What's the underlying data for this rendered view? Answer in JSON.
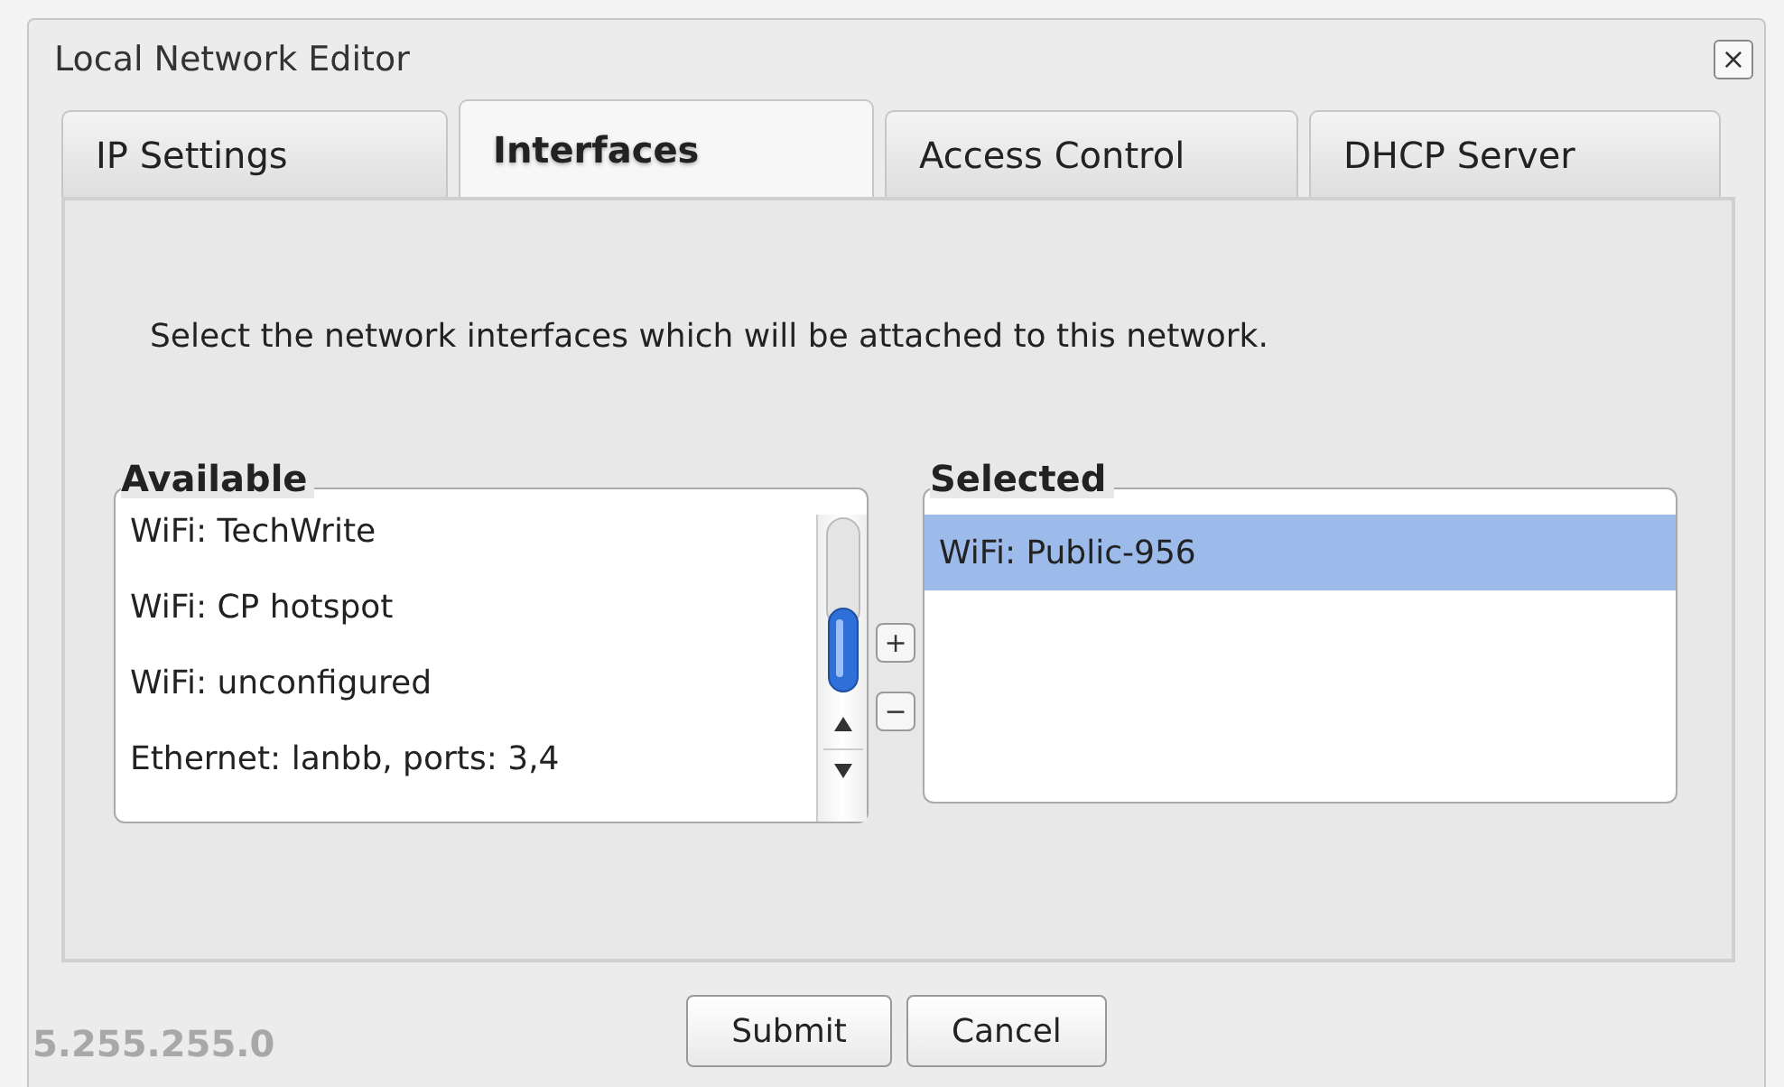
{
  "window": {
    "title": "Local Network Editor",
    "close": "×"
  },
  "tabs": [
    {
      "label": "IP Settings",
      "selected": false
    },
    {
      "label": "Interfaces",
      "selected": true
    },
    {
      "label": "Access Control",
      "selected": false
    },
    {
      "label": "DHCP Server",
      "selected": false
    }
  ],
  "instruction": "Select the network interfaces which will be attached to this network.",
  "available": {
    "legend": "Available",
    "items": [
      {
        "label": "WiFi: TechWrite",
        "selected": false
      },
      {
        "label": "WiFi: CP hotspot",
        "selected": false
      },
      {
        "label": "WiFi: unconfigured",
        "selected": false
      },
      {
        "label": "Ethernet: lanbb, ports: 3,4",
        "selected": false
      }
    ]
  },
  "move_buttons": [
    "+",
    "−"
  ],
  "selected_list": {
    "legend": "Selected",
    "items": [
      {
        "label": "WiFi: Public-956",
        "selected": true
      }
    ]
  },
  "background_text": "5.255.255.0",
  "buttons": [
    "Submit",
    "Cancel"
  ]
}
